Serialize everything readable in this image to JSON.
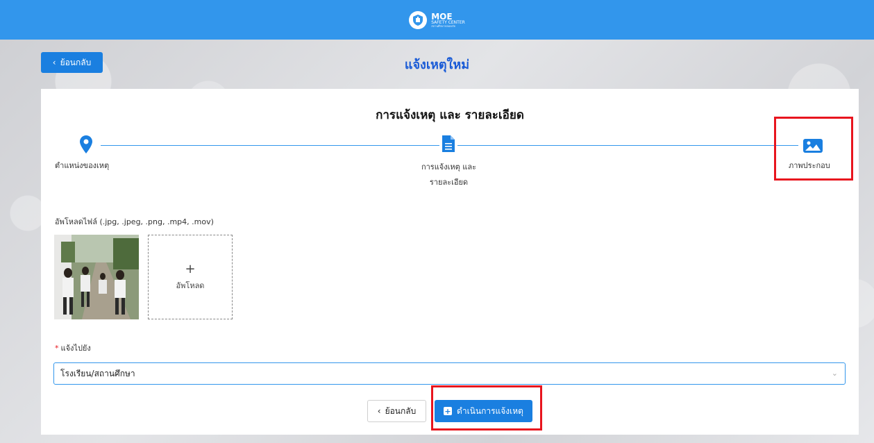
{
  "header": {
    "logo_title": "MOE",
    "logo_subtitle": "SAFETY CENTER",
    "logo_tagline": "สถานศึกษาปลอดภัย",
    "icon": "shield-logo-icon",
    "color": "#3296ec"
  },
  "nav": {
    "back_label": "ย้อนกลับ",
    "page_title": "แจ้งเหตุใหม่"
  },
  "form": {
    "title": "การแจ้งเหตุ และ รายละเอียด",
    "steps": [
      {
        "label": "ตำแหน่งของเหตุ",
        "icon": "map-pin-icon"
      },
      {
        "label": "การแจ้งเหตุ และ",
        "label2": "รายละเอียด",
        "icon": "document-icon"
      },
      {
        "label": "ภาพประกอบ",
        "icon": "image-icon"
      }
    ],
    "upload_label": "อัพโหลดไฟล์ (.jpg, .jpeg, .png, .mp4, .mov)",
    "upload_plus": "+",
    "upload_button": "อัพโหลด",
    "notify_to_label": "แจ้งไปยัง",
    "required_mark": "*",
    "notify_to_value": "โรงเรียน/สถานศึกษา",
    "back_button": "ย้อนกลับ",
    "submit_button": "ดำเนินการแจ้งเหตุ"
  },
  "colors": {
    "accent": "#1a7fe0",
    "highlight": "#e8151e"
  }
}
